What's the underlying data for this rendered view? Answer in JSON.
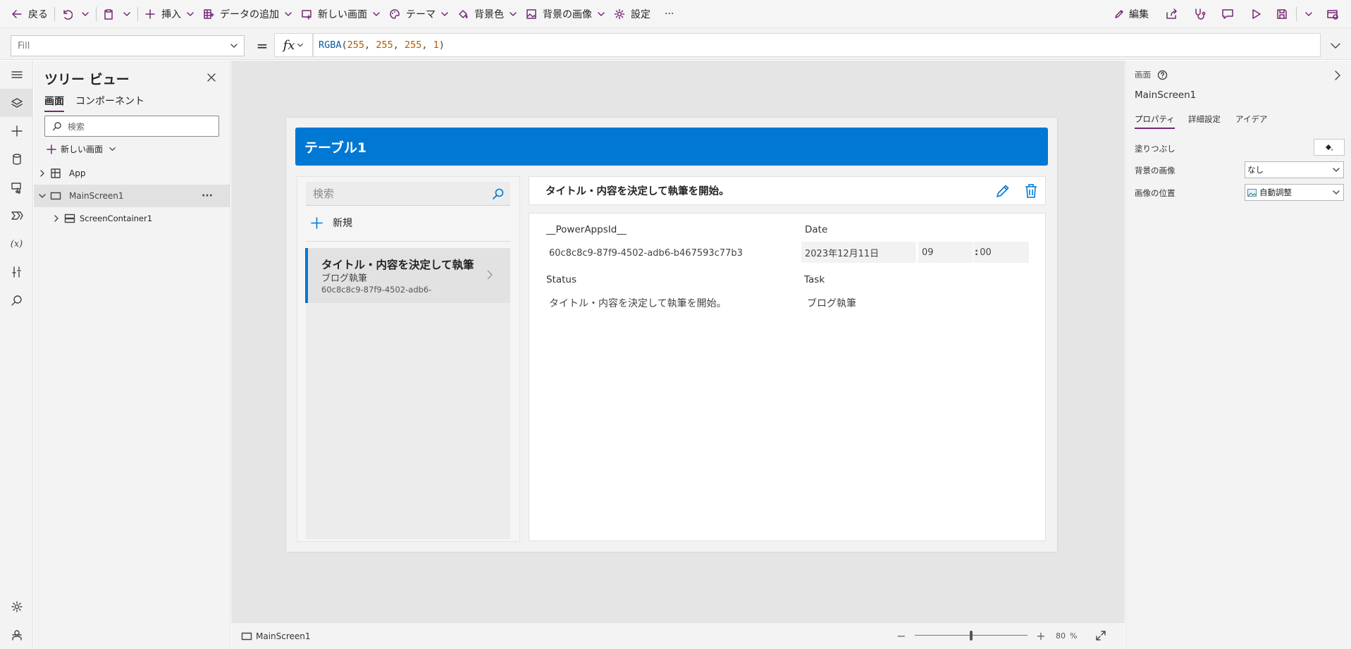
{
  "toolbar": {
    "back": "戻る",
    "insert": "挿入",
    "add_data": "データの追加",
    "new_screen": "新しい画面",
    "theme": "テーマ",
    "background_color": "背景色",
    "background_image": "背景の画像",
    "settings": "設定",
    "more": "···",
    "edit": "編集"
  },
  "formula_bar": {
    "property": "Fill",
    "equals": "=",
    "fx": "fx",
    "formula_fn": "RGBA",
    "formula_open": "(",
    "formula_args": [
      "255",
      "255",
      "255",
      "1"
    ],
    "formula_sep": ", ",
    "formula_close": ")"
  },
  "tree_view": {
    "title": "ツリー ビュー",
    "tab_screens": "画面",
    "tab_components": "コンポーネント",
    "search_placeholder": "検索",
    "new_screen": "新しい画面",
    "nodes": {
      "app": "App",
      "main_screen": "MainScreen1",
      "container": "ScreenContainer1"
    },
    "more": "···"
  },
  "app_screen": {
    "header_title": "テーブル1",
    "gallery": {
      "search_placeholder": "検索",
      "new_label": "新規",
      "item": {
        "title": "タイトル・内容を決定して執筆",
        "subtitle": "ブログ執筆",
        "id": "60c8c8c9-87f9-4502-adb6-"
      }
    },
    "detail": {
      "title": "タイトル・内容を決定して執筆を開始。",
      "fields": {
        "id_label": "__PowerAppsId__",
        "id_value": "60c8c8c9-87f9-4502-adb6-b467593c77b3",
        "date_label": "Date",
        "date_value": "2023年12月11日",
        "hour_value": "09",
        "colon": ":",
        "minute_value": "00",
        "status_label": "Status",
        "status_value": "タイトル・内容を決定して執筆を開始。",
        "task_label": "Task",
        "task_value": "ブログ執筆"
      }
    }
  },
  "status_bar": {
    "screen_name": "MainScreen1",
    "zoom_value": "80",
    "zoom_unit": "%",
    "zoom_fraction": 0.8
  },
  "properties_panel": {
    "type_label": "画面",
    "name": "MainScreen1",
    "tabs": [
      "プロパティ",
      "詳細設定",
      "アイデア"
    ],
    "fill_label": "塗りつぶし",
    "bg_image_label": "背景の画像",
    "bg_image_value": "なし",
    "image_position_label": "画像の位置",
    "image_position_value": "自動調整"
  },
  "colors": {
    "accent": "#742774",
    "header_blue": "#0078d4"
  },
  "icons": [
    "back-arrow-icon",
    "undo-icon",
    "clipboard-icon",
    "plus-icon",
    "database-icon",
    "new-screen-icon",
    "palette-icon",
    "paint-bucket-icon",
    "image-icon",
    "gear-icon",
    "pencil-icon",
    "share-icon",
    "stethoscope-icon",
    "comment-icon",
    "play-icon",
    "save-icon",
    "publish-icon",
    "search-icon",
    "trash-icon",
    "chevron-right-icon",
    "expand-icon"
  ]
}
